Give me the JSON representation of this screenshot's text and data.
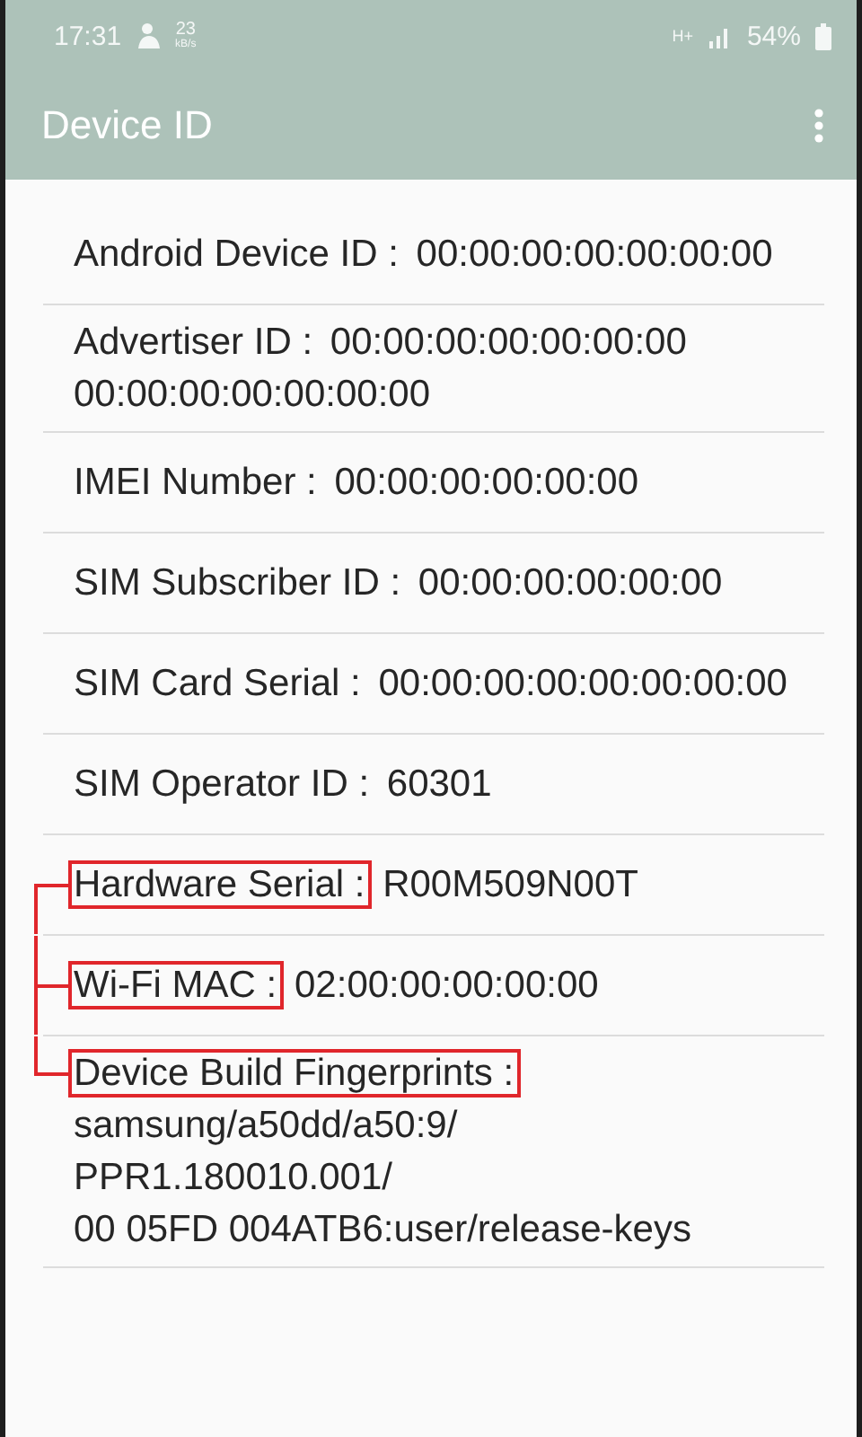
{
  "status_bar": {
    "time": "17:31",
    "speed_value": "23",
    "speed_unit": "kB/s",
    "network": "H+",
    "battery": "54%"
  },
  "app_bar": {
    "title": "Device ID"
  },
  "rows": [
    {
      "label": "Android Device ID :",
      "value": "00:00:00:00:00:00:00",
      "highlighted": false
    },
    {
      "label": "Advertiser ID :",
      "value": "00:00:00:00:00:00:00 00:00:00:00:00:00:00",
      "highlighted": false
    },
    {
      "label": "IMEI Number :",
      "value": "00:00:00:00:00:00",
      "highlighted": false
    },
    {
      "label": "SIM Subscriber ID :",
      "value": "00:00:00:00:00:00",
      "highlighted": false
    },
    {
      "label": "SIM Card Serial :",
      "value": "00:00:00:00:00:00:00:00",
      "highlighted": false
    },
    {
      "label": "SIM Operator ID :",
      "value": "60301",
      "highlighted": false
    },
    {
      "label": "Hardware Serial :",
      "value": "R00M509N00T",
      "highlighted": true
    },
    {
      "label": "Wi-Fi MAC :",
      "value": "02:00:00:00:00:00",
      "highlighted": true
    },
    {
      "label": "Device Build Fingerprints :",
      "value": "samsung/a50dd/a50:9/\nPPR1.180010.001/\n00 05FD 004ATB6:user/release-keys",
      "highlighted": true
    }
  ]
}
